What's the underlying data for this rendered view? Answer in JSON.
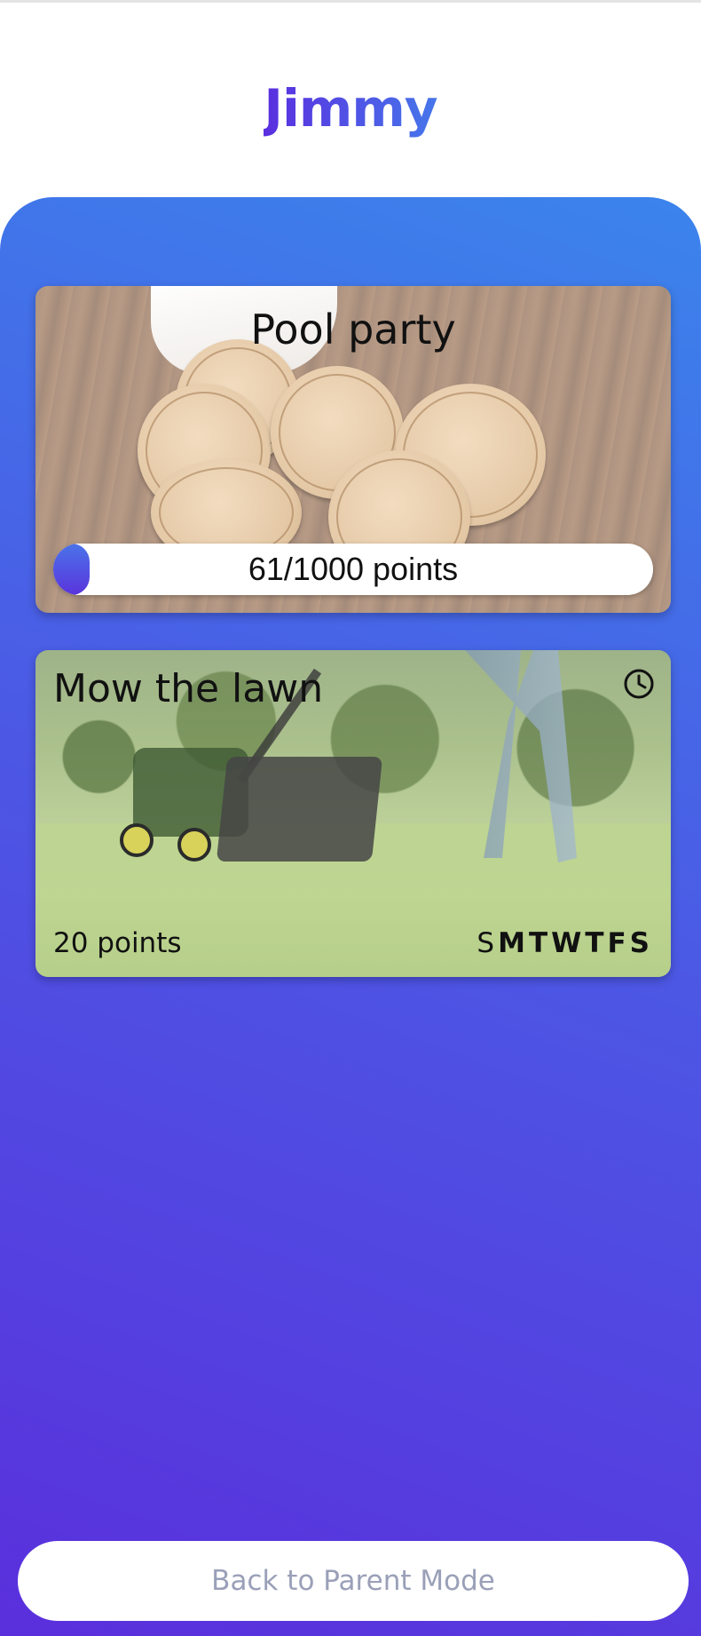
{
  "header": {
    "child_name": "Jimmy"
  },
  "reward": {
    "title": "Pool party",
    "points_current": 61,
    "points_goal": 1000,
    "progress_fraction": 0.061,
    "progress_label": "61/1000 points"
  },
  "chore": {
    "title": "Mow the lawn",
    "points_label": "20 points",
    "icon": "clock-icon",
    "days": [
      {
        "label": "S",
        "active": false
      },
      {
        "label": "M",
        "active": true
      },
      {
        "label": "T",
        "active": true
      },
      {
        "label": "W",
        "active": true
      },
      {
        "label": "T",
        "active": true
      },
      {
        "label": "F",
        "active": true
      },
      {
        "label": "S",
        "active": true
      }
    ]
  },
  "footer": {
    "back_label": "Back to Parent Mode"
  },
  "colors": {
    "accent_purple": "#5a2fdc",
    "accent_blue": "#3b84ec"
  }
}
